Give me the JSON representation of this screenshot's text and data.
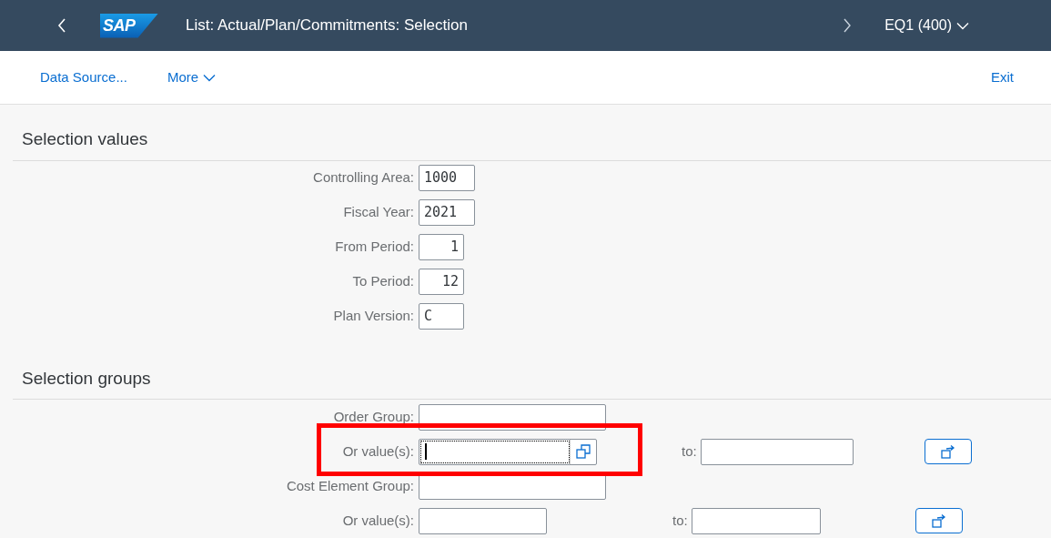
{
  "shell": {
    "logo": "SAP",
    "title": "List: Actual/Plan/Commitments: Selection",
    "system": "EQ1 (400)"
  },
  "toolbar": {
    "left": [
      "Data Source...",
      "More"
    ],
    "right": "Exit"
  },
  "selection_values": {
    "title": "Selection values",
    "fields": [
      {
        "label": "Controlling Area:",
        "value": "1000",
        "kind": "text"
      },
      {
        "label": "Fiscal Year:",
        "value": "2021",
        "kind": "text"
      },
      {
        "label": "From Period:",
        "value": "1",
        "kind": "numeric"
      },
      {
        "label": "To Period:",
        "value": "12",
        "kind": "numeric"
      },
      {
        "label": "Plan Version:",
        "value": "C",
        "kind": "text"
      }
    ]
  },
  "selection_groups": {
    "title": "Selection groups",
    "rows": [
      {
        "label": "Order Group:",
        "kind": "group"
      },
      {
        "label": "Or value(s):",
        "kind": "range",
        "focused": true,
        "to_label": "to:"
      },
      {
        "label": "Cost Element Group:",
        "kind": "group"
      },
      {
        "label": "Or value(s):",
        "kind": "range",
        "focused": false,
        "to_label": "to:"
      }
    ]
  }
}
